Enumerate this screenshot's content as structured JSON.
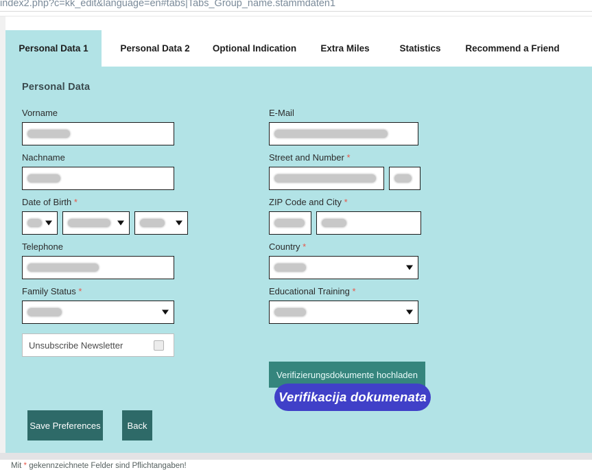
{
  "browser": {
    "url": "index2.php?c=kk_edit&language=en#tabs|Tabs_Group_name.stammdaten1"
  },
  "tabs": [
    {
      "label": "Personal Data 1",
      "active": true
    },
    {
      "label": "Personal Data 2",
      "active": false
    },
    {
      "label": "Optional Indication",
      "active": false
    },
    {
      "label": "Extra Miles",
      "active": false
    },
    {
      "label": "Statistics",
      "active": false
    },
    {
      "label": "Recommend a Friend",
      "active": false
    }
  ],
  "form": {
    "section_title": "Personal Data",
    "left": {
      "vorname": {
        "label": "Vorname",
        "required": false,
        "value": ""
      },
      "nachname": {
        "label": "Nachname",
        "required": false,
        "value": ""
      },
      "date_of_birth": {
        "label": "Date of Birth",
        "required": true,
        "day": "",
        "month": "",
        "year": ""
      },
      "telephone": {
        "label": "Telephone",
        "required": false,
        "value": ""
      },
      "family_status": {
        "label": "Family Status",
        "required": true,
        "value": ""
      },
      "newsletter": {
        "label": "Unsubscribe Newsletter",
        "checked": false
      }
    },
    "right": {
      "email": {
        "label": "E-Mail",
        "required": false,
        "value": ""
      },
      "street": {
        "label": "Street and Number",
        "required": true,
        "street_value": "",
        "number_value": ""
      },
      "zip_city": {
        "label": "ZIP Code and City",
        "required": true,
        "zip_value": "",
        "city_value": ""
      },
      "country": {
        "label": "Country",
        "required": true,
        "value": ""
      },
      "education": {
        "label": "Educational Training",
        "required": true,
        "value": ""
      }
    },
    "required_marker": "*"
  },
  "buttons": {
    "save": "Save Preferences",
    "back": "Back",
    "upload_documents": "Verifizierungsdokumente hochladen",
    "overlay_label": "Verifikacija dokumenata"
  },
  "footer": {
    "note_prefix": "Mit ",
    "note_star": "*",
    "note_suffix": " gekennzeichnete Felder sind Pflichtangaben!"
  },
  "colors": {
    "page_background": "#b2e3e6",
    "tab_active": "#b2e3e6",
    "button_dark": "#2e6a68",
    "button_upload": "#35857d",
    "overlay_blue": "#4040c8",
    "required_red": "#e8574a"
  }
}
